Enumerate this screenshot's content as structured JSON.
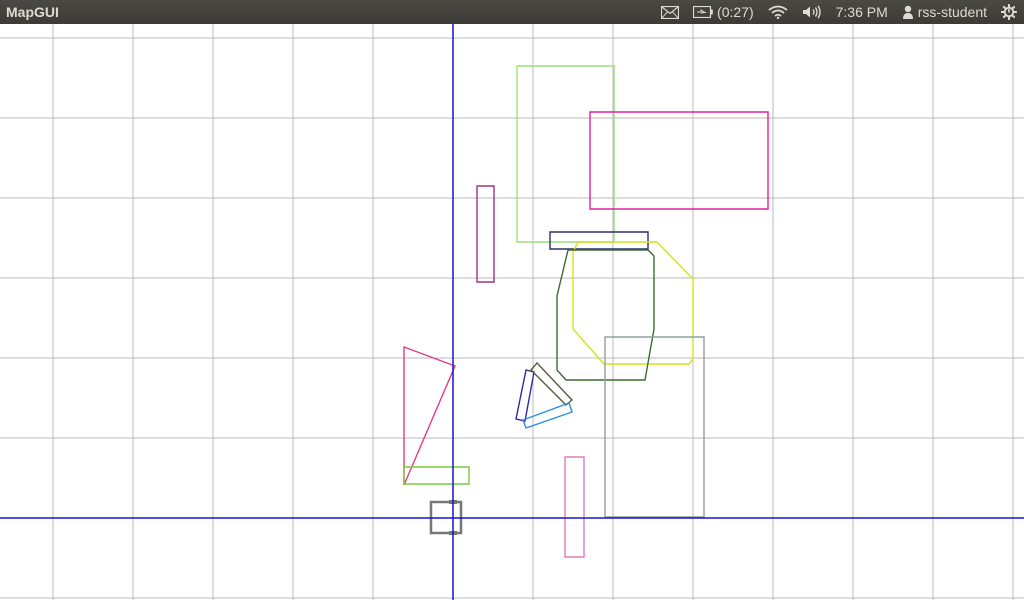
{
  "window": {
    "app_title": "MapGUI"
  },
  "indicators": {
    "mail_icon": "envelope-icon",
    "battery_icon": "battery-charging-icon",
    "battery_text": "(0:27)",
    "wifi_icon": "wifi-icon",
    "volume_icon": "volume-icon",
    "clock": "7:36 PM",
    "user_icon": "person-icon",
    "user_name": "rss-student",
    "power_icon": "gear-power-icon"
  },
  "colors": {
    "topbar": "#3c3b37",
    "grid": "#b9b9b9",
    "axes": "#1515d0"
  },
  "map": {
    "grid": true,
    "shapes": [
      {
        "name": "light-green-rectangle",
        "color": "#9ee07a"
      },
      {
        "name": "magenta-rectangle",
        "color": "#e0209d"
      },
      {
        "name": "purple-thin-rectangle",
        "color": "#a0337f"
      },
      {
        "name": "navy-bar",
        "color": "#2b2f6b"
      },
      {
        "name": "yellow-octagon",
        "color": "#cde619"
      },
      {
        "name": "dark-green-polygon",
        "color": "#3e6b34"
      },
      {
        "name": "gray-rectangle",
        "color": "#8fa0a3"
      },
      {
        "name": "pink-triangle",
        "color": "#e43b86"
      },
      {
        "name": "green-bar",
        "color": "#7ac83a"
      },
      {
        "name": "blue-quad",
        "color": "#2d2aa5"
      },
      {
        "name": "olive-quad",
        "color": "#5a5a3a"
      },
      {
        "name": "cyan-quad",
        "color": "#2a8ee0"
      },
      {
        "name": "pink-thin-rectangle",
        "color": "#e07ac0"
      },
      {
        "name": "robot-square",
        "color": "#777777"
      }
    ]
  }
}
